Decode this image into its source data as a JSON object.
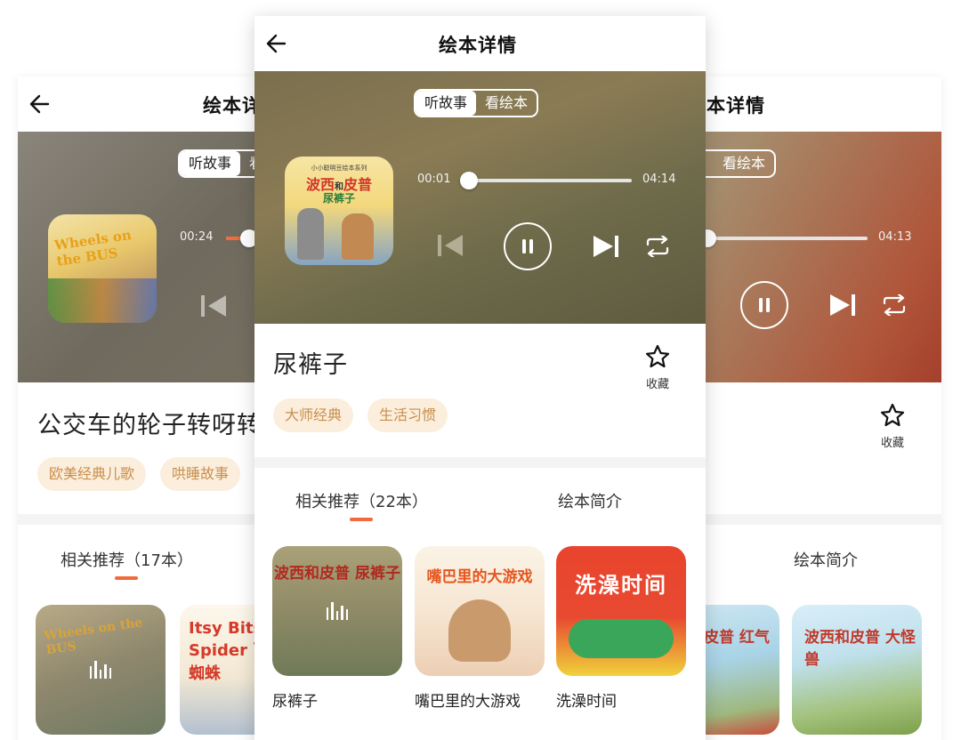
{
  "screens": {
    "left": {
      "title": "绘本详情",
      "seg": [
        "听故事",
        "看绘本"
      ],
      "time_current": "00:24",
      "progress_fraction": 0.06,
      "book_title": "公交车的轮子转呀转",
      "tags": [
        "欧美经典儿歌",
        "哄睡故事"
      ],
      "tab_related": "相关推荐（17本）",
      "recs": [
        {
          "cover_text": "Wheels on the BUS"
        },
        {
          "cover_text": "Itsy Bitsy Spider 可爱小蜘蛛"
        }
      ]
    },
    "center": {
      "title": "绘本详情",
      "seg": [
        "听故事",
        "看绘本"
      ],
      "time_current": "00:01",
      "time_total": "04:14",
      "progress_fraction": 0.0,
      "cover_series": "小小聪明豆绘本系列",
      "cover_title_a": "波西",
      "cover_title_b": "和",
      "cover_title_c": "皮普",
      "cover_subtitle": "尿裤子",
      "book_title": "尿裤子",
      "fav_label": "收藏",
      "tags": [
        "大师经典",
        "生活习惯"
      ],
      "tab_related": "相关推荐（22本）",
      "tab_intro": "绘本简介",
      "recs": [
        {
          "name": "尿裤子",
          "cover_text": "波西和皮普 尿裤子"
        },
        {
          "name": "嘴巴里的大游戏",
          "cover_text": "嘴巴里的大游戏"
        },
        {
          "name": "洗澡时间",
          "cover_text": "洗澡时间"
        }
      ]
    },
    "right": {
      "title": "绘本详情",
      "seg_visible": "看绘本",
      "time_total": "04:13",
      "fav_label": "收藏",
      "tab_intro": "绘本简介",
      "recs": [
        {
          "cover_text": "波西和皮普 红气球"
        },
        {
          "cover_text": "波西和皮普 大怪兽"
        }
      ]
    }
  },
  "colors": {
    "accent": "#f26b3a",
    "tag_bg": "#fbeedc",
    "tag_text": "#c98f4d"
  }
}
